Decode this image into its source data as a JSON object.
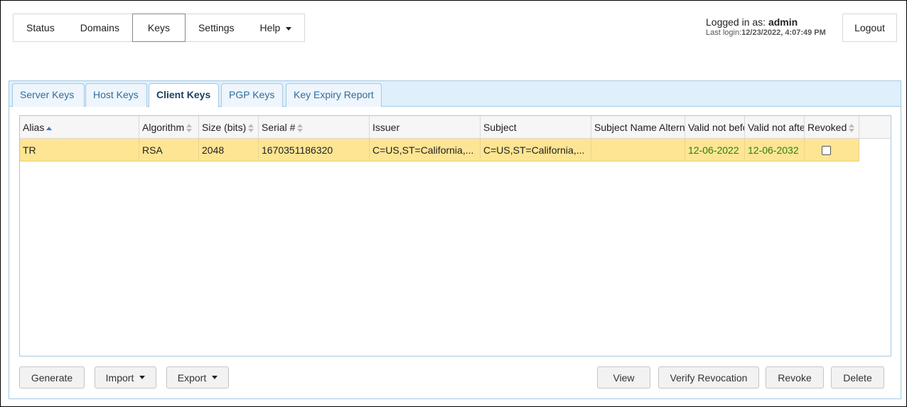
{
  "nav": {
    "items": [
      "Status",
      "Domains",
      "Keys",
      "Settings",
      "Help"
    ],
    "active": "Keys"
  },
  "login": {
    "prefix": "Logged in as: ",
    "user": "admin",
    "last_login_label": "Last login:",
    "last_login_value": "12/23/2022, 4:07:49 PM",
    "logout_label": "Logout"
  },
  "tabs": [
    "Server Keys",
    "Host Keys",
    "Client Keys",
    "PGP Keys",
    "Key Expiry Report"
  ],
  "active_tab": "Client Keys",
  "grid": {
    "columns": [
      "Alias",
      "Algorithm",
      "Size (bits)",
      "Serial #",
      "Issuer",
      "Subject",
      "Subject Name Altern",
      "Valid not befo",
      "Valid not afte",
      "Revoked"
    ],
    "rows": [
      {
        "alias": "TR",
        "algorithm": "RSA",
        "size": "2048",
        "serial": "1670351186320",
        "issuer": "C=US,ST=California,...",
        "subject": "C=US,ST=California,...",
        "san": "",
        "valid_from": "12-06-2022",
        "valid_to": "12-06-2032",
        "revoked": false
      }
    ]
  },
  "buttons": {
    "generate": "Generate",
    "import": "Import",
    "export": "Export",
    "view": "View",
    "verify_revocation": "Verify Revocation",
    "revoke": "Revoke",
    "delete": "Delete"
  },
  "colors": {
    "selected_row": "#fde593",
    "tab_bar": "#dfeffc",
    "date_text": "#2e7d10"
  }
}
